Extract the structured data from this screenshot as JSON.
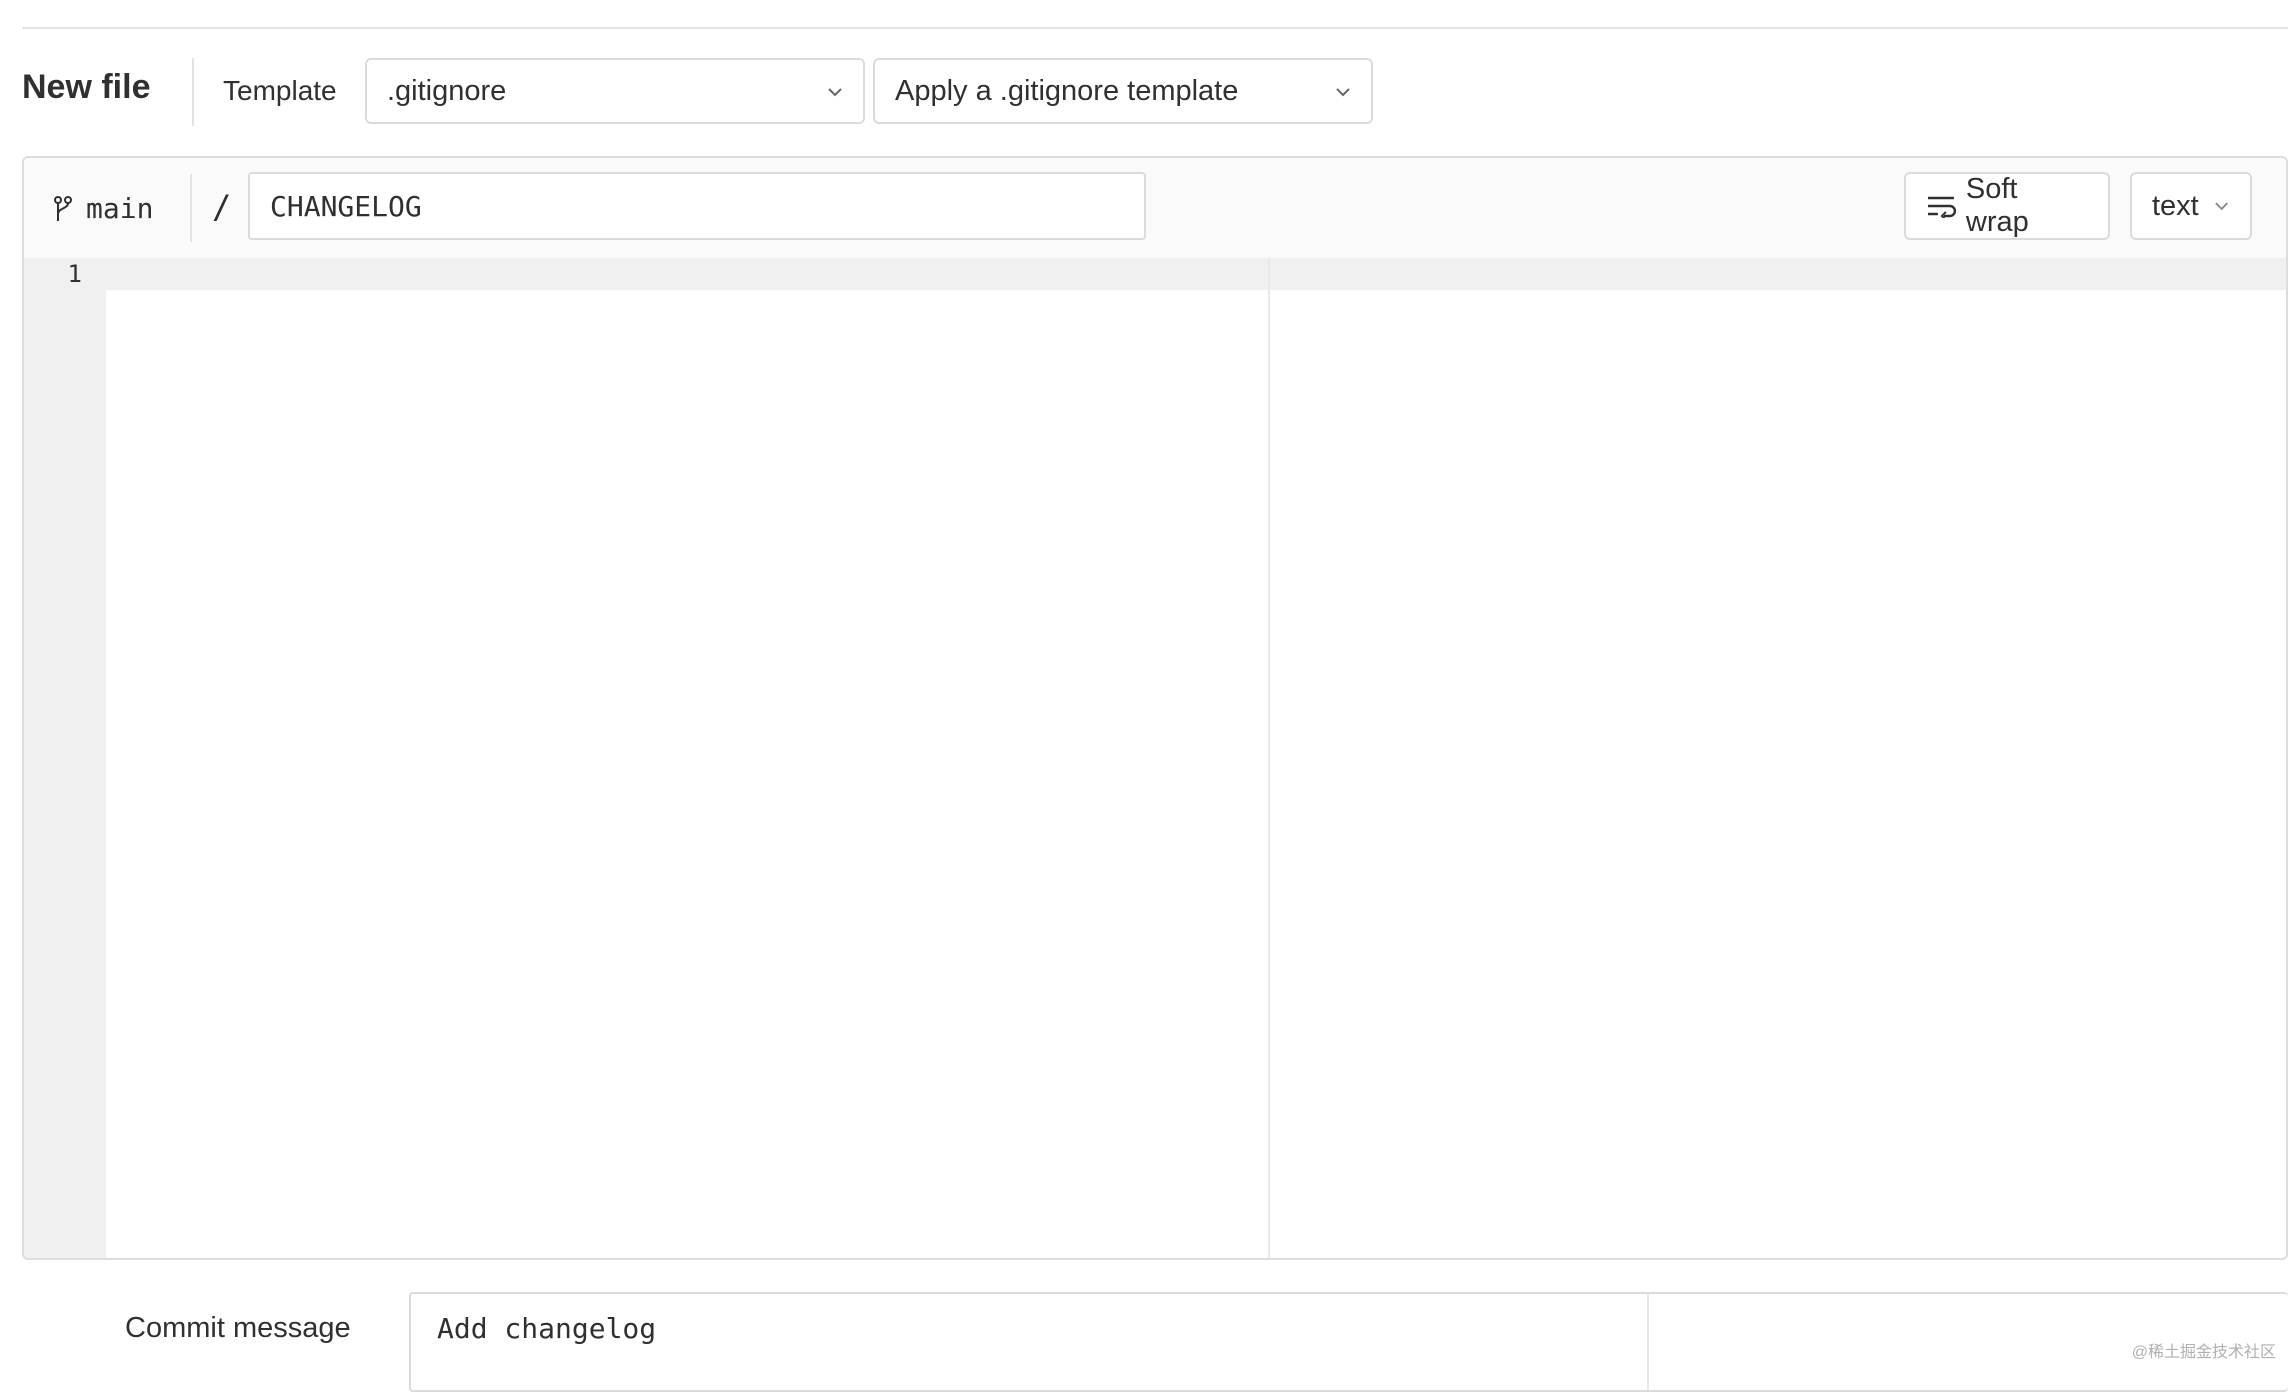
{
  "header": {
    "title": "New file",
    "template_label": "Template",
    "template_type": ".gitignore",
    "template_apply": "Apply a .gitignore template"
  },
  "editor": {
    "branch": "main",
    "separator": "/",
    "filename": "CHANGELOG",
    "soft_wrap_label": "Soft wrap",
    "language": "text",
    "line_numbers": [
      "1"
    ]
  },
  "commit": {
    "label": "Commit message",
    "message": "Add changelog"
  },
  "watermark": "@稀土掘金技术社区"
}
